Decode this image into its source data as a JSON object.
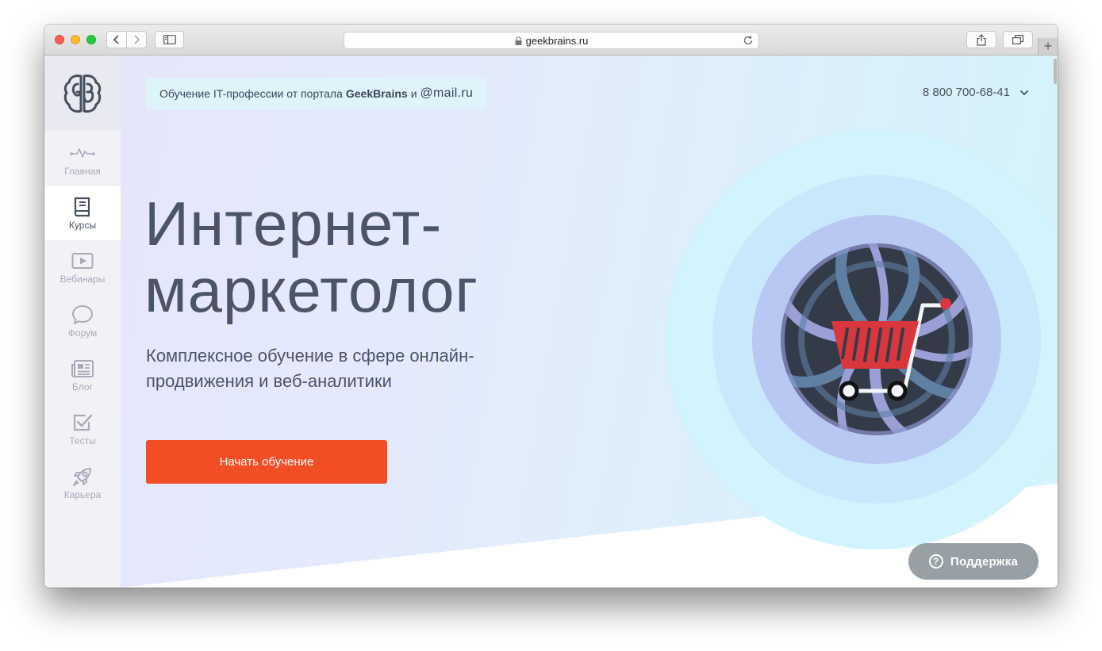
{
  "browser": {
    "url": "geekbrains.ru",
    "new_tab_label": "+"
  },
  "sidebar": {
    "items": [
      {
        "label": "Главная",
        "icon": "pulse-icon"
      },
      {
        "label": "Курсы",
        "icon": "book-icon"
      },
      {
        "label": "Вебинары",
        "icon": "play-icon"
      },
      {
        "label": "Форум",
        "icon": "chat-bubble-icon"
      },
      {
        "label": "Блог",
        "icon": "newspaper-icon"
      },
      {
        "label": "Тесты",
        "icon": "checkbox-icon"
      },
      {
        "label": "Карьера",
        "icon": "rocket-icon"
      }
    ],
    "active_item": "Курсы"
  },
  "header": {
    "badge_text": "Обучение IT-профессии от портала",
    "badge_brand": "GeekBrains",
    "badge_and": "и",
    "badge_partner": "@mail.ru",
    "phone": "8 800 700-68-41"
  },
  "hero": {
    "title_line1": "Интернет-",
    "title_line2": "маркетолог",
    "subtitle": "Комплексное обучение в сфере онлайн-продвижения и веб-аналитики",
    "cta_label": "Начать обучение"
  },
  "support": {
    "label": "Поддержка",
    "icon_glyph": "?"
  },
  "colors": {
    "accent": "#f24e26",
    "text": "#4a5567",
    "sidebar_bg": "#f1f1f6",
    "cart": "#d9363e"
  }
}
